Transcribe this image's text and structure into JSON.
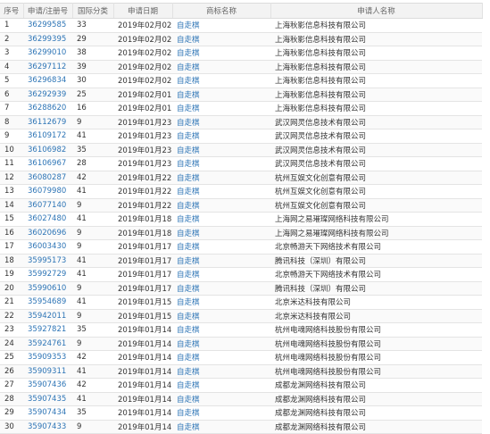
{
  "table": {
    "headers": [
      "序号",
      "申请/注册号",
      "国际分类",
      "申请日期",
      "商标名称",
      "申请人名称"
    ],
    "rows": [
      [
        "1",
        "36299585",
        "33",
        "2019年02月02日",
        "自走棋",
        "上海秋影信息科技有限公司"
      ],
      [
        "2",
        "36299395",
        "29",
        "2019年02月02日",
        "自走棋",
        "上海秋影信息科技有限公司"
      ],
      [
        "3",
        "36299010",
        "38",
        "2019年02月02日",
        "自走棋",
        "上海秋影信息科技有限公司"
      ],
      [
        "4",
        "36297112",
        "39",
        "2019年02月02日",
        "自走棋",
        "上海秋影信息科技有限公司"
      ],
      [
        "5",
        "36296834",
        "30",
        "2019年02月02日",
        "自走棋",
        "上海秋影信息科技有限公司"
      ],
      [
        "6",
        "36292939",
        "25",
        "2019年02月01日",
        "自走棋",
        "上海秋影信息科技有限公司"
      ],
      [
        "7",
        "36288620",
        "16",
        "2019年02月01日",
        "自走棋",
        "上海秋影信息科技有限公司"
      ],
      [
        "8",
        "36112679",
        "9",
        "2019年01月23日",
        "自走棋",
        "武汉网灵信息技术有限公司"
      ],
      [
        "9",
        "36109172",
        "41",
        "2019年01月23日",
        "自走棋",
        "武汉网灵信息技术有限公司"
      ],
      [
        "10",
        "36106982",
        "35",
        "2019年01月23日",
        "自走棋",
        "武汉网灵信息技术有限公司"
      ],
      [
        "11",
        "36106967",
        "28",
        "2019年01月23日",
        "自走棋",
        "武汉网灵信息技术有限公司"
      ],
      [
        "12",
        "36080287",
        "42",
        "2019年01月22日",
        "自走棋",
        "杭州互娱文化创意有限公司"
      ],
      [
        "13",
        "36079980",
        "41",
        "2019年01月22日",
        "自走棋",
        "杭州互娱文化创意有限公司"
      ],
      [
        "14",
        "36077140",
        "9",
        "2019年01月22日",
        "自走棋",
        "杭州互娱文化创意有限公司"
      ],
      [
        "15",
        "36027480",
        "41",
        "2019年01月18日",
        "自走棋",
        "上海网之易璀璨网络科技有限公司"
      ],
      [
        "16",
        "36020696",
        "9",
        "2019年01月18日",
        "自走棋",
        "上海网之易璀璨网络科技有限公司"
      ],
      [
        "17",
        "36003430",
        "9",
        "2019年01月17日",
        "自走棋",
        "北京畅游天下网络技术有限公司"
      ],
      [
        "18",
        "35995173",
        "41",
        "2019年01月17日",
        "自走棋",
        "腾讯科技（深圳）有限公司"
      ],
      [
        "19",
        "35992729",
        "41",
        "2019年01月17日",
        "自走棋",
        "北京畅游天下网络技术有限公司"
      ],
      [
        "20",
        "35990610",
        "9",
        "2019年01月17日",
        "自走棋",
        "腾讯科技（深圳）有限公司"
      ],
      [
        "21",
        "35954689",
        "41",
        "2019年01月15日",
        "自走棋",
        "北京米达科技有限公司"
      ],
      [
        "22",
        "35942011",
        "9",
        "2019年01月15日",
        "自走棋",
        "北京米达科技有限公司"
      ],
      [
        "23",
        "35927821",
        "35",
        "2019年01月14日",
        "自走棋",
        "杭州电魂网络科技股份有限公司"
      ],
      [
        "24",
        "35924761",
        "9",
        "2019年01月14日",
        "自走棋",
        "杭州电魂网络科技股份有限公司"
      ],
      [
        "25",
        "35909353",
        "42",
        "2019年01月14日",
        "自走棋",
        "杭州电魂网络科技股份有限公司"
      ],
      [
        "26",
        "35909311",
        "41",
        "2019年01月14日",
        "自走棋",
        "杭州电魂网络科技股份有限公司"
      ],
      [
        "27",
        "35907436",
        "42",
        "2019年01月14日",
        "自走棋",
        "成都龙渊网络科技有限公司"
      ],
      [
        "28",
        "35907435",
        "41",
        "2019年01月14日",
        "自走棋",
        "成都龙渊网络科技有限公司"
      ],
      [
        "29",
        "35907434",
        "35",
        "2019年01月14日",
        "自走棋",
        "成都龙渊网络科技有限公司"
      ],
      [
        "30",
        "35907433",
        "9",
        "2019年01月14日",
        "自走棋",
        "成都龙渊网络科技有限公司"
      ]
    ]
  },
  "colors": {
    "link": "#2e75b6",
    "header_bg": "#f3f3f3",
    "border": "#e4e4e4"
  }
}
